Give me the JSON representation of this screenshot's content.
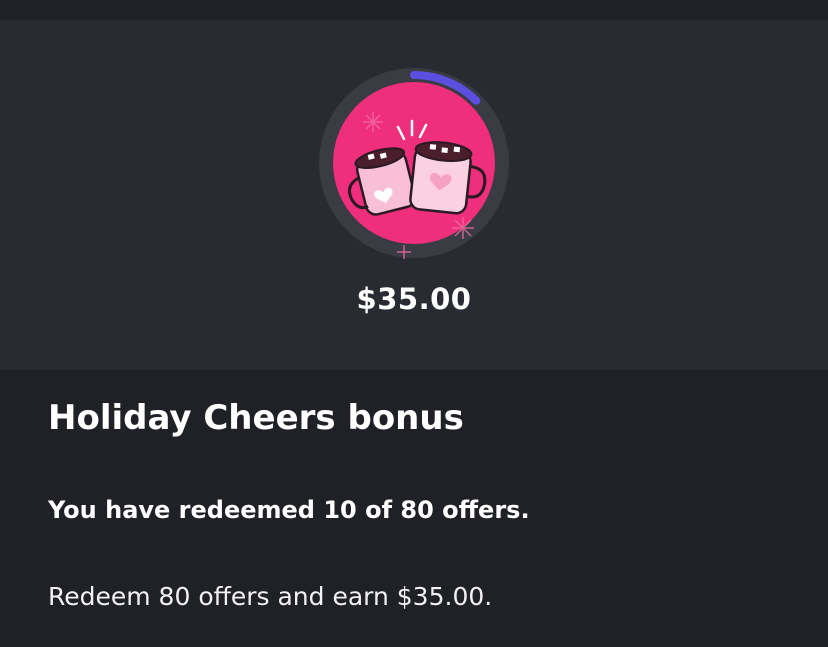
{
  "bonus": {
    "amount": "$35.00",
    "title": "Holiday Cheers bonus",
    "progress_text": "You have redeemed 10 of 80 offers.",
    "description": "Redeem 80 offers and earn $35.00.",
    "redeemed": 10,
    "total": 80,
    "badge_icon": "hot-cocoa-mugs-icon"
  },
  "colors": {
    "background": "#1f2127",
    "hero_background": "#292b33",
    "ring_track": "#3a3c44",
    "ring_progress": "#5b4fe0",
    "badge_pink": "#ef2f7c"
  }
}
